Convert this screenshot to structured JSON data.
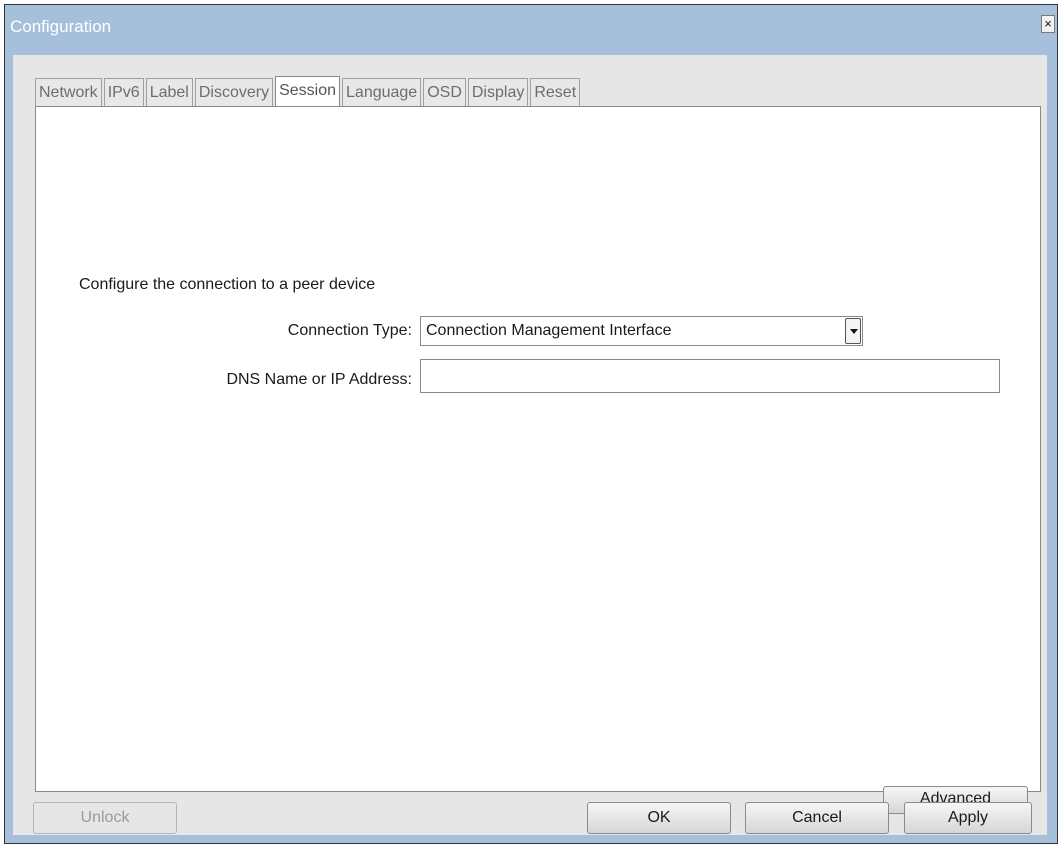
{
  "window": {
    "title": "Configuration",
    "close_label": "×"
  },
  "tabs": [
    {
      "label": "Network",
      "active": false
    },
    {
      "label": "IPv6",
      "active": false
    },
    {
      "label": "Label",
      "active": false
    },
    {
      "label": "Discovery",
      "active": false
    },
    {
      "label": "Session",
      "active": true
    },
    {
      "label": "Language",
      "active": false
    },
    {
      "label": "OSD",
      "active": false
    },
    {
      "label": "Display",
      "active": false
    },
    {
      "label": "Reset",
      "active": false
    }
  ],
  "session": {
    "description": "Configure the connection to a peer device",
    "connection_type_label": "Connection Type:",
    "connection_type_value": "Connection Management Interface",
    "dns_label": "DNS Name or IP Address:",
    "dns_value": "",
    "advanced_label": "Advanced"
  },
  "footer": {
    "unlock_label": "Unlock",
    "ok_label": "OK",
    "cancel_label": "Cancel",
    "apply_label": "Apply"
  },
  "colors": {
    "titlebar": "#a6bfda",
    "client_bg": "#e6e6e6",
    "panel_bg": "#ffffff"
  }
}
